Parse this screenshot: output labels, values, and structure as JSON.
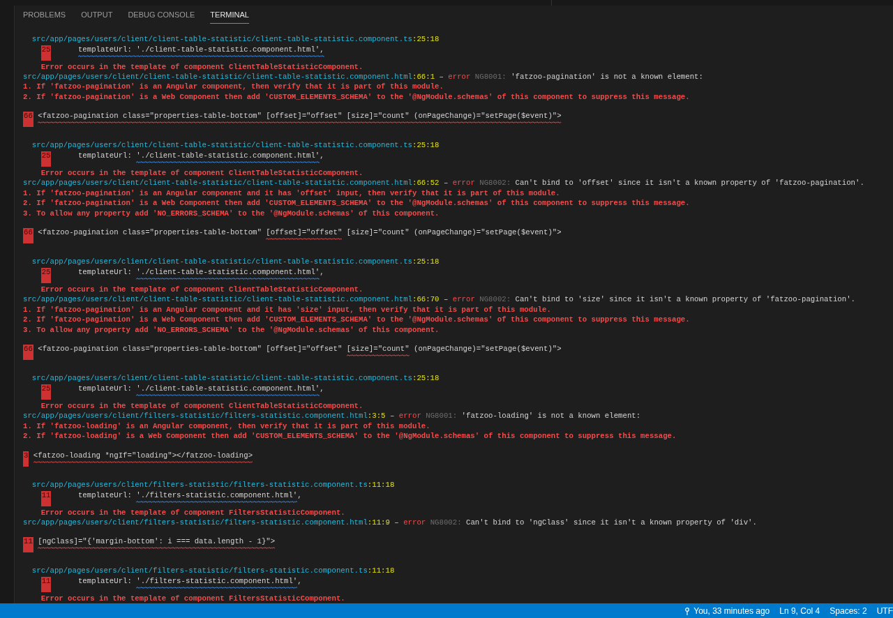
{
  "tabs": [
    {
      "label": "PROBLEMS",
      "selected": false
    },
    {
      "label": "OUTPUT",
      "selected": false
    },
    {
      "label": "DEBUG CONSOLE",
      "selected": false
    },
    {
      "label": "TERMINAL",
      "selected": true
    }
  ],
  "entries": [
    {
      "kind": "context",
      "path": "src/app/pages/users/client/client-table-statistic/client-table-statistic.component.ts",
      "pos": ":25:18",
      "snippet": {
        "line_no": "25",
        "marked": "templateUrl: './client-table-statistic.component.html',",
        "underline": {
          "kind": "info"
        }
      },
      "note": "Error occurs in the template of component ClientTableStatisticComponent."
    },
    {
      "kind": "error",
      "path": "src/app/pages/users/client/client-table-statistic/client-table-statistic.component.html",
      "pos": ":66:1",
      "dash": "–",
      "label": "error",
      "code": "NG8001:",
      "message": "'fatzoo-pagination' is not a known element:",
      "hints": [
        "1. If 'fatzoo-pagination' is an Angular component, then verify that it is part of this module.",
        "2. If 'fatzoo-pagination' is a Web Component then add 'CUSTOM_ELEMENTS_SCHEMA' to the '@NgModule.schemas' of this component to suppress this message."
      ]
    },
    {
      "kind": "snippet",
      "line_no": "66",
      "marked": "<fatzoo-pagination class=\"properties-table-bottom\" [offset]=\"offset\" [size]=\"count\" (onPageChange)=\"setPage($event)\">",
      "underline": {
        "kind": "error"
      }
    },
    {
      "kind": "context",
      "path": "src/app/pages/users/client/client-table-statistic/client-table-statistic.component.ts",
      "pos": ":25:18",
      "snippet": {
        "line_no": "25",
        "before": "templateUrl: ",
        "marked": "'./client-table-statistic.component.html'",
        "after": ",",
        "underline": {
          "kind": "info"
        }
      },
      "note": "Error occurs in the template of component ClientTableStatisticComponent."
    },
    {
      "kind": "error",
      "path": "src/app/pages/users/client/client-table-statistic/client-table-statistic.component.html",
      "pos": ":66:52",
      "dash": "–",
      "label": "error",
      "code": "NG8002:",
      "message": "Can't bind to 'offset' since it isn't a known property of 'fatzoo-pagination'.",
      "hints": [
        "1. If 'fatzoo-pagination' is an Angular component and it has 'offset' input, then verify that it is part of this module.",
        "2. If 'fatzoo-pagination' is a Web Component then add 'CUSTOM_ELEMENTS_SCHEMA' to the '@NgModule.schemas' of this component to suppress this message.",
        "3. To allow any property add 'NO_ERRORS_SCHEMA' to the '@NgModule.schemas' of this component."
      ]
    },
    {
      "kind": "snippet",
      "line_no": "66",
      "before": "<fatzoo-pagination class=\"properties-table-bottom\" ",
      "marked": "[offset]=\"offset\"",
      "after": " [size]=\"count\" (onPageChange)=\"setPage($event)\">",
      "underline": {
        "kind": "error"
      }
    },
    {
      "kind": "context",
      "path": "src/app/pages/users/client/client-table-statistic/client-table-statistic.component.ts",
      "pos": ":25:18",
      "snippet": {
        "line_no": "25",
        "before": "templateUrl: ",
        "marked": "'./client-table-statistic.component.html'",
        "after": ",",
        "underline": {
          "kind": "info"
        }
      },
      "note": "Error occurs in the template of component ClientTableStatisticComponent."
    },
    {
      "kind": "error",
      "path": "src/app/pages/users/client/client-table-statistic/client-table-statistic.component.html",
      "pos": ":66:70",
      "dash": "–",
      "label": "error",
      "code": "NG8002:",
      "message": "Can't bind to 'size' since it isn't a known property of 'fatzoo-pagination'.",
      "hints": [
        "1. If 'fatzoo-pagination' is an Angular component and it has 'size' input, then verify that it is part of this module.",
        "2. If 'fatzoo-pagination' is a Web Component then add 'CUSTOM_ELEMENTS_SCHEMA' to the '@NgModule.schemas' of this component to suppress this message.",
        "3. To allow any property add 'NO_ERRORS_SCHEMA' to the '@NgModule.schemas' of this component."
      ]
    },
    {
      "kind": "snippet",
      "line_no": "66",
      "before": "<fatzoo-pagination class=\"properties-table-bottom\" [offset]=\"offset\" ",
      "marked": "[size]=\"count\"",
      "after": " (onPageChange)=\"setPage($event)\">",
      "underline": {
        "kind": "error"
      }
    },
    {
      "kind": "context",
      "path": "src/app/pages/users/client/client-table-statistic/client-table-statistic.component.ts",
      "pos": ":25:18",
      "snippet": {
        "line_no": "25",
        "before": "templateUrl: ",
        "marked": "'./client-table-statistic.component.html'",
        "after": ",",
        "underline": {
          "kind": "info"
        }
      },
      "note": "Error occurs in the template of component ClientTableStatisticComponent."
    },
    {
      "kind": "error",
      "path": "src/app/pages/users/client/filters-statistic/filters-statistic.component.html",
      "pos": ":3:5",
      "dash": "–",
      "label": "error",
      "code": "NG8001:",
      "message": "'fatzoo-loading' is not a known element:",
      "hints": [
        "1. If 'fatzoo-loading' is an Angular component, then verify that it is part of this module.",
        "2. If 'fatzoo-loading' is a Web Component then add 'CUSTOM_ELEMENTS_SCHEMA' to the '@NgModule.schemas' of this component to suppress this message."
      ]
    },
    {
      "kind": "snippet",
      "line_no": "3",
      "marked": "<fatzoo-loading *ngIf=\"loading\"></fatzoo-loading>",
      "underline": {
        "kind": "error"
      }
    },
    {
      "kind": "context",
      "path": "src/app/pages/users/client/filters-statistic/filters-statistic.component.ts",
      "pos": ":11:18",
      "snippet": {
        "line_no": "11",
        "before": "templateUrl: ",
        "marked": "'./filters-statistic.component.html'",
        "after": ",",
        "underline": {
          "kind": "info"
        }
      },
      "note": "Error occurs in the template of component FiltersStatisticComponent."
    },
    {
      "kind": "error",
      "path": "src/app/pages/users/client/filters-statistic/filters-statistic.component.html",
      "pos": ":11:9",
      "dash": "–",
      "label": "error",
      "code": "NG8002:",
      "message": "Can't bind to 'ngClass' since it isn't a known property of 'div'."
    },
    {
      "kind": "snippet",
      "line_no": "11",
      "marked": "[ngClass]=\"{'margin-bottom': i === data.length - 1}\">",
      "underline": {
        "kind": "error"
      }
    },
    {
      "kind": "context",
      "path": "src/app/pages/users/client/filters-statistic/filters-statistic.component.ts",
      "pos": ":11:18",
      "snippet": {
        "line_no": "11",
        "before": "templateUrl: ",
        "marked": "'./filters-statistic.component.html'",
        "after": ",",
        "underline": {
          "kind": "info"
        }
      },
      "note": "Error occurs in the template of component FiltersStatisticComponent."
    }
  ],
  "status_bar": {
    "blame": "You, 33 minutes ago",
    "items": [
      "Ln 9, Col 4",
      "Spaces: 2",
      "UTF"
    ]
  }
}
